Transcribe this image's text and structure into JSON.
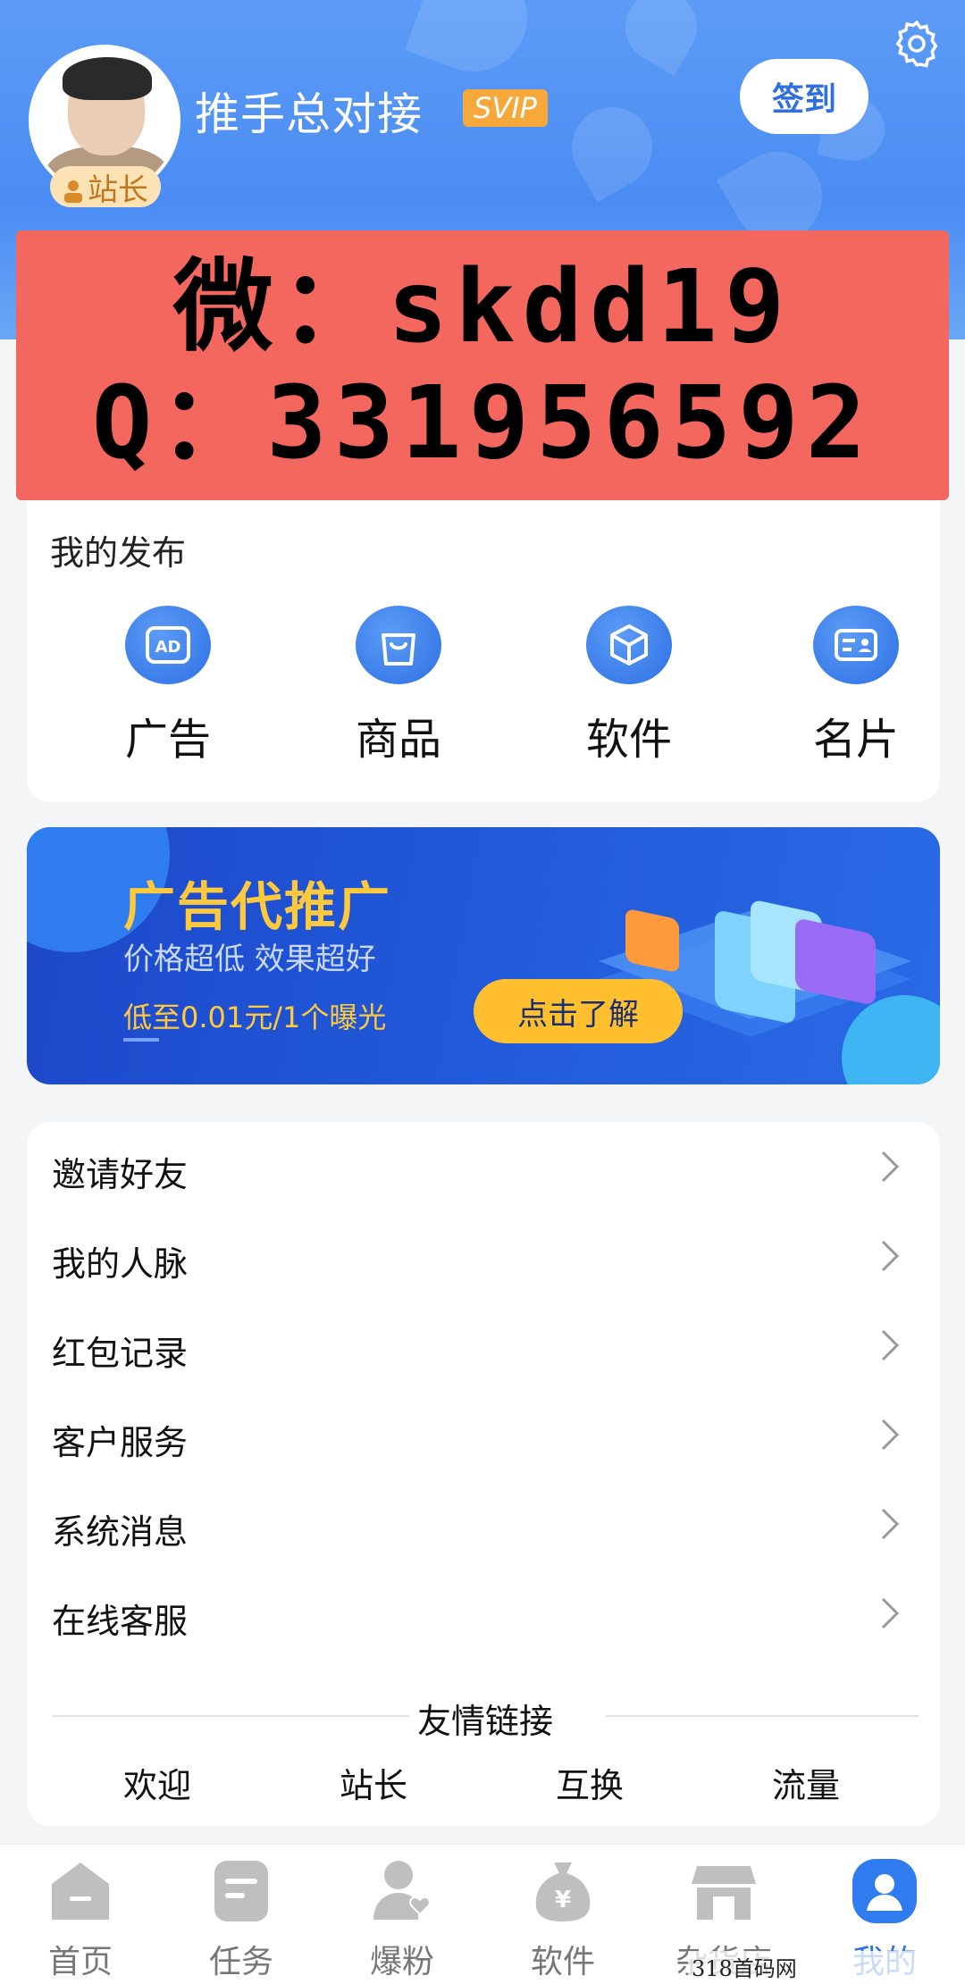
{
  "header": {
    "username": "推手总对接",
    "vip_badge": "SVIP",
    "role_badge": "站长",
    "signin_label": "签到"
  },
  "contact_overlay": {
    "line1": "微：skdd19",
    "line2": "Q：331956592"
  },
  "publish": {
    "title": "我的发布",
    "items": [
      {
        "label": "广告",
        "icon": "ad-icon"
      },
      {
        "label": "商品",
        "icon": "shopping-bag-icon"
      },
      {
        "label": "软件",
        "icon": "cube-icon"
      },
      {
        "label": "名片",
        "icon": "business-card-icon"
      }
    ]
  },
  "banner": {
    "title": "广告代推广",
    "subtitle": "价格超低 效果超好",
    "price": "低至0.01元/1个曝光",
    "button": "点击了解"
  },
  "menu": {
    "items": [
      {
        "label": "邀请好友"
      },
      {
        "label": "我的人脉"
      },
      {
        "label": "红包记录"
      },
      {
        "label": "客户服务"
      },
      {
        "label": "系统消息"
      },
      {
        "label": "在线客服"
      }
    ],
    "links_title": "友情链接",
    "links": [
      "欢迎",
      "站长",
      "互换",
      "流量"
    ]
  },
  "bottom_nav": {
    "items": [
      {
        "label": "首页",
        "icon": "home-icon"
      },
      {
        "label": "任务",
        "icon": "task-icon"
      },
      {
        "label": "爆粉",
        "icon": "user-heart-icon"
      },
      {
        "label": "软件",
        "icon": "money-bag-icon"
      },
      {
        "label": "杂货店",
        "icon": "store-icon"
      },
      {
        "label": "我的",
        "icon": "profile-icon"
      }
    ],
    "active_index": 5
  },
  "watermark": "318首码网 www.E318.com",
  "colors": {
    "header_blue": "#5c9cf6",
    "accent_blue": "#2f6fe0",
    "contact_red": "#f4675e",
    "gold": "#ffc93e"
  }
}
